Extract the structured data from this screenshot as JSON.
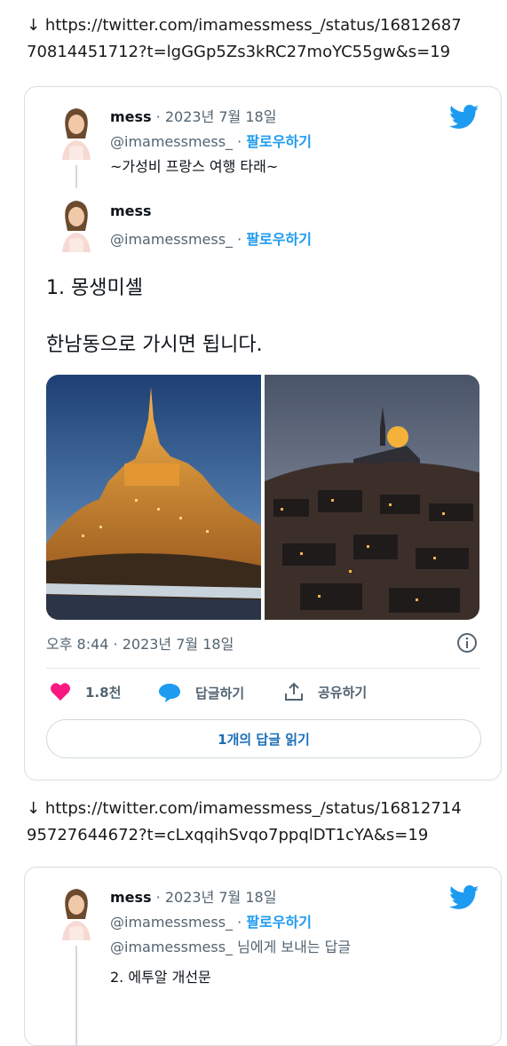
{
  "urls": [
    {
      "arrow": "↓",
      "line1": "https://twitter.com/imamessmess_/status/16812687",
      "line2": "70814451712?t=lgGGp5Zs3kRC27moYC55gw&s=19"
    },
    {
      "arrow": "↓",
      "line1": "https://twitter.com/imamessmess_/status/16812714",
      "line2": "95727644672?t=cLxqqihSvqo7ppqlDT1cYA&s=19"
    }
  ],
  "tweet1": {
    "parent": {
      "name": "mess",
      "date": "· 2023년 7월 18일",
      "handle": "@imamessmess_",
      "dot": "·",
      "follow": "팔로우하기",
      "text": "~가성비 프랑스 여행 타래~"
    },
    "main": {
      "name": "mess",
      "handle": "@imamessmess_",
      "dot": "·",
      "follow": "팔로우하기",
      "text_line1": "1. 몽생미셸",
      "text_line2": "한남동으로 가시면 됩니다.",
      "timestamp": "오후 8:44 · 2023년 7월 18일"
    },
    "actions": {
      "likes": "1.8천",
      "reply": "답글하기",
      "share": "공유하기"
    },
    "read_replies": "1개의 답글 읽기"
  },
  "tweet2": {
    "name": "mess",
    "date": "· 2023년 7월 18일",
    "handle": "@imamessmess_",
    "dot": "·",
    "follow": "팔로우하기",
    "reply_to": "@imamessmess_ 님에게 보내는 답글",
    "text": "2. 에투알 개선문"
  },
  "colors": {
    "twitter_blue": "#1d9bf0",
    "like_pink": "#f91880",
    "reply_blue": "#1d9bf0",
    "meta_gray": "#536471"
  },
  "icons": [
    "download-arrow-icon",
    "twitter-bird-icon",
    "heart-icon",
    "speech-bubble-icon",
    "share-icon",
    "info-icon"
  ]
}
